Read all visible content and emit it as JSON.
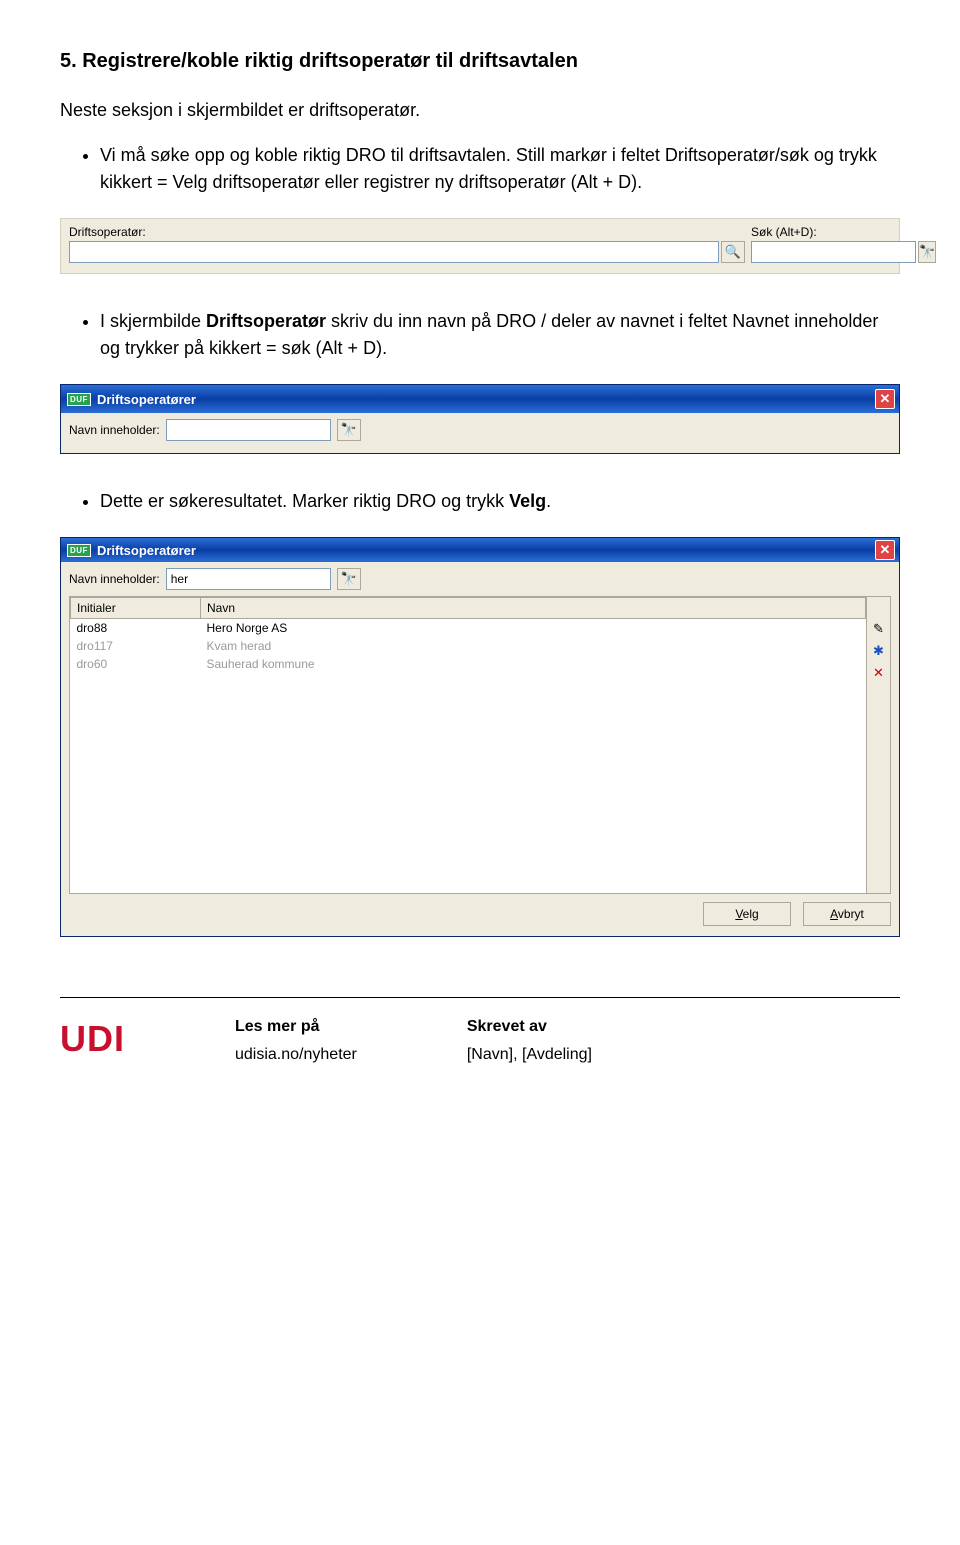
{
  "heading": "5. Registrere/koble riktig driftsoperatør til driftsavtalen",
  "intro": "Neste seksjon i skjermbildet er driftsoperatør.",
  "bullet1": "Vi må søke opp og koble riktig DRO til driftsavtalen. Still markør i feltet Driftsoperatør/søk og trykk kikkert = Velg driftsoperatør eller registrer ny driftsoperatør (Alt + D).",
  "shot1": {
    "label_driftsoperator": "Driftsoperatør:",
    "label_sok": "Søk (Alt+D):",
    "value_driftsoperator": "",
    "value_sok": ""
  },
  "bullet2_prefix": "I skjermbilde ",
  "bullet2_bold": "Driftsoperatør",
  "bullet2_suffix": " skriv du inn navn på DRO / deler av navnet i feltet Navnet inneholder og trykker på kikkert = søk (Alt + D).",
  "shot2": {
    "title": "Driftsoperatører",
    "duf": "DUF",
    "navn_label": "Navn inneholder:",
    "navn_value": ""
  },
  "bullet3_prefix": "Dette er søkeresultatet. Marker riktig DRO og trykk ",
  "bullet3_bold": "Velg",
  "bullet3_suffix": ".",
  "shot3": {
    "title": "Driftsoperatører",
    "duf": "DUF",
    "navn_label": "Navn inneholder:",
    "navn_value": "her",
    "col_initialer": "Initialer",
    "col_navn": "Navn",
    "rows": [
      {
        "init": "dro88",
        "navn": "Hero Norge AS",
        "dim": false
      },
      {
        "init": "dro117",
        "navn": "Kvam herad",
        "dim": true
      },
      {
        "init": "dro60",
        "navn": "Sauherad kommune",
        "dim": true
      }
    ],
    "btn_velg": "Velg",
    "btn_avbryt": "Avbryt"
  },
  "footer": {
    "logo": "UDI",
    "col1_h": "Les mer på",
    "col1_v": "udisia.no/nyheter",
    "col2_h": "Skrevet av",
    "col2_v": "[Navn], [Avdeling]"
  },
  "icons": {
    "magnifier": "🔍",
    "binoculars": "🔭",
    "close": "✕",
    "pencil": "✎",
    "star": "✱",
    "delete": "✕"
  }
}
